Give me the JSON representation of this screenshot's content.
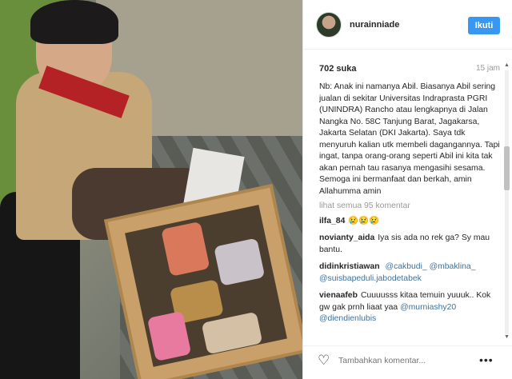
{
  "post": {
    "username": "nurainniade",
    "follow_label": "Ikuti",
    "likes": "702 suka",
    "date": "15 jam",
    "caption": "Nb: Anak ini namanya Abil. Biasanya Abil sering jualan di sekitar Universitas Indraprasta PGRI (UNINDRA) Rancho atau lengkapnya di Jalan Nangka No. 58C Tanjung Barat, Jagakarsa, Jakarta Selatan (DKI Jakarta). Saya tdk menyuruh kalian utk membeli dagangannya. Tapi ingat, tanpa orang-orang seperti Abil ini kita tak akan pernah tau rasanya mengasihi sesama. Semoga ini bermanfaat dan berkah, amin Allahumma amin",
    "view_all": "lihat semua 95 komentar"
  },
  "comments": [
    {
      "user": "ilfa_84",
      "text": "😢😢😢"
    },
    {
      "user": "novianty_aida",
      "text": "Iya sis ada no rek ga? Sy mau bantu."
    },
    {
      "user": "didinkristiawan",
      "mention1": "@cakbudi_",
      "mention2": "@mbaklina_",
      "mention3": "@suisbapeduli.jabodetabek"
    },
    {
      "user": "vienaafeb",
      "text": "Cuuuusss kitaa temuin yuuuk.. Kok gw gak prnh liaat yaa",
      "mention1": "@murniashy20",
      "mention2": "@diendienlubis"
    }
  ],
  "footer": {
    "comment_placeholder": "Tambahkan komentar...",
    "heart_icon": "heart-outline-icon",
    "more_icon": "more-options-icon"
  },
  "colors": {
    "follow_button": "#3897f0",
    "mention": "#3f729b"
  }
}
